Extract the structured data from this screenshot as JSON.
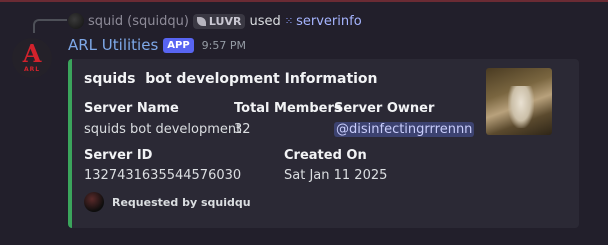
{
  "reply": {
    "user_name": "squid",
    "user_handle": "(squidqu)",
    "tag": "LUVR",
    "used_text": "used",
    "command": "serverinfo",
    "command_icon": "slash-command-icon"
  },
  "message": {
    "bot_name": "ARL Utilities",
    "app_badge": "APP",
    "timestamp": "9:57 PM",
    "avatar_letter": "A",
    "avatar_text": "ARL"
  },
  "embed": {
    "accent_color": "#3ba55c",
    "title": "squids  bot development Information",
    "fields": {
      "server_name_label": "Server Name",
      "server_name_value": "squids bot development",
      "total_members_label": "Total Members",
      "total_members_value": "32",
      "server_owner_label": "Server Owner",
      "server_owner_value": "@disinfectingrrrennn",
      "server_id_label": "Server ID",
      "server_id_value": "1327431635544576030",
      "created_on_label": "Created On",
      "created_on_value": "Sat Jan 11 2025"
    },
    "footer": "Requested by squidqu"
  }
}
